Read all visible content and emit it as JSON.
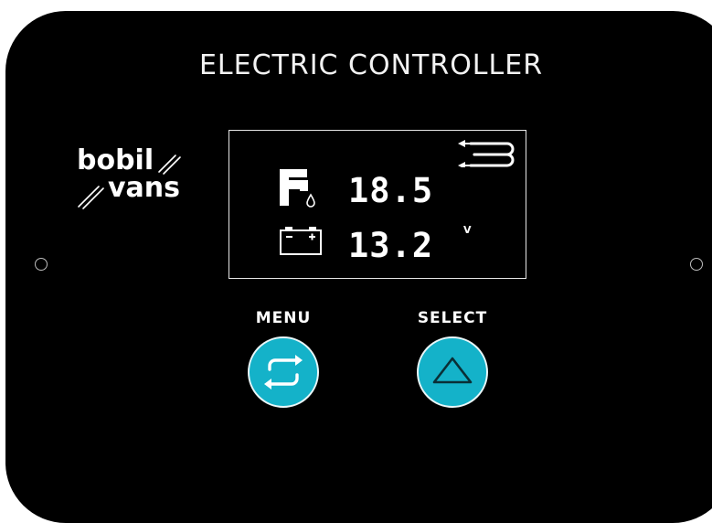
{
  "panel": {
    "title": "ELECTRIC CONTROLLER",
    "background_color": "#000000",
    "accent_color": "#14b2c9"
  },
  "brand": {
    "line1": "bobil",
    "line2": "vans"
  },
  "display": {
    "water_value": "18.5",
    "voltage_value": "13.2",
    "voltage_unit": "V",
    "icons": {
      "water": "faucet-icon",
      "battery": "battery-icon",
      "flow": "heat-exchanger-icon"
    }
  },
  "buttons": {
    "menu_label": "MENU",
    "select_label": "SELECT",
    "menu_icon": "cycle-icon",
    "select_icon": "triangle-up-icon"
  }
}
